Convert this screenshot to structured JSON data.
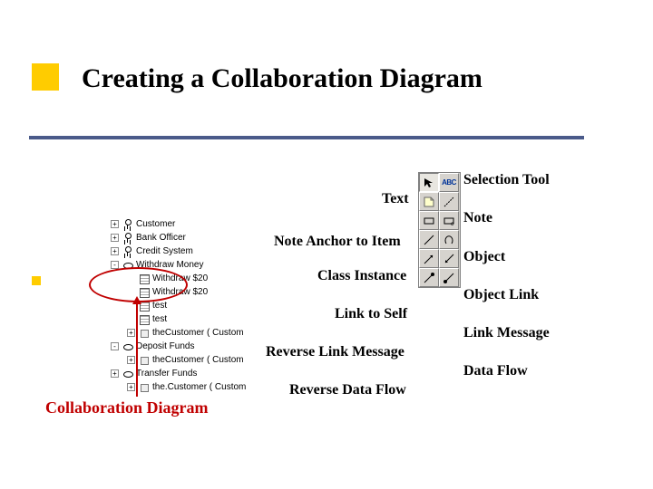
{
  "title": "Creating a Collaboration Diagram",
  "caption": "Collaboration Diagram",
  "tree": {
    "items": [
      {
        "label": "Customer",
        "icon": "actor",
        "indent": 1,
        "exp": "+"
      },
      {
        "label": "Bank Officer",
        "icon": "actor",
        "indent": 1,
        "exp": "+"
      },
      {
        "label": "Credit System",
        "icon": "actor",
        "indent": 1,
        "exp": "+"
      },
      {
        "label": "Withdraw Money",
        "icon": "oval",
        "indent": 1,
        "exp": "-"
      },
      {
        "label": "Withdraw $20",
        "icon": "diagram",
        "indent": 2,
        "exp": ""
      },
      {
        "label": "Withdraw $20",
        "icon": "diagram",
        "indent": 2,
        "exp": ""
      },
      {
        "label": "test",
        "icon": "diagram",
        "indent": 2,
        "exp": ""
      },
      {
        "label": "test",
        "icon": "diagram",
        "indent": 2,
        "exp": ""
      },
      {
        "label": "theCustomer ( Custom",
        "icon": "cube",
        "indent": 2,
        "exp": "+"
      },
      {
        "label": "Deposit Funds",
        "icon": "oval",
        "indent": 1,
        "exp": "-"
      },
      {
        "label": "theCustomer ( Custom",
        "icon": "cube",
        "indent": 2,
        "exp": "+"
      },
      {
        "label": "Transfer Funds",
        "icon": "oval",
        "indent": 1,
        "exp": "+"
      },
      {
        "label": "the.Customer ( Custom",
        "icon": "cube",
        "indent": 2,
        "exp": "+"
      }
    ]
  },
  "labels": {
    "selection_tool": "Selection Tool",
    "text": "Text",
    "note": "Note",
    "note_anchor": "Note Anchor to Item",
    "object": "Object",
    "class_instance": "Class Instance",
    "object_link": "Object Link",
    "link_to_self": "Link to Self",
    "link_message": "Link Message",
    "reverse_link_message": "Reverse Link Message",
    "data_flow": "Data Flow",
    "reverse_data_flow": "Reverse Data Flow"
  },
  "tools": [
    {
      "name": "selection-tool",
      "kind": "arrow",
      "pressed": true
    },
    {
      "name": "text-tool",
      "kind": "abc",
      "pressed": false
    },
    {
      "name": "note-tool",
      "kind": "note",
      "pressed": false
    },
    {
      "name": "anchor-tool",
      "kind": "anchor",
      "pressed": false
    },
    {
      "name": "object-tool",
      "kind": "rect",
      "pressed": false
    },
    {
      "name": "class-instance",
      "kind": "rectc",
      "pressed": false
    },
    {
      "name": "object-link",
      "kind": "diag",
      "pressed": false
    },
    {
      "name": "link-to-self",
      "kind": "selfloop",
      "pressed": false
    },
    {
      "name": "link-message",
      "kind": "arrowr",
      "pressed": false
    },
    {
      "name": "reverse-link-msg",
      "kind": "arrowl",
      "pressed": false
    },
    {
      "name": "data-flow",
      "kind": "dfr",
      "pressed": false
    },
    {
      "name": "reverse-data-flow",
      "kind": "dfl",
      "pressed": false
    }
  ]
}
